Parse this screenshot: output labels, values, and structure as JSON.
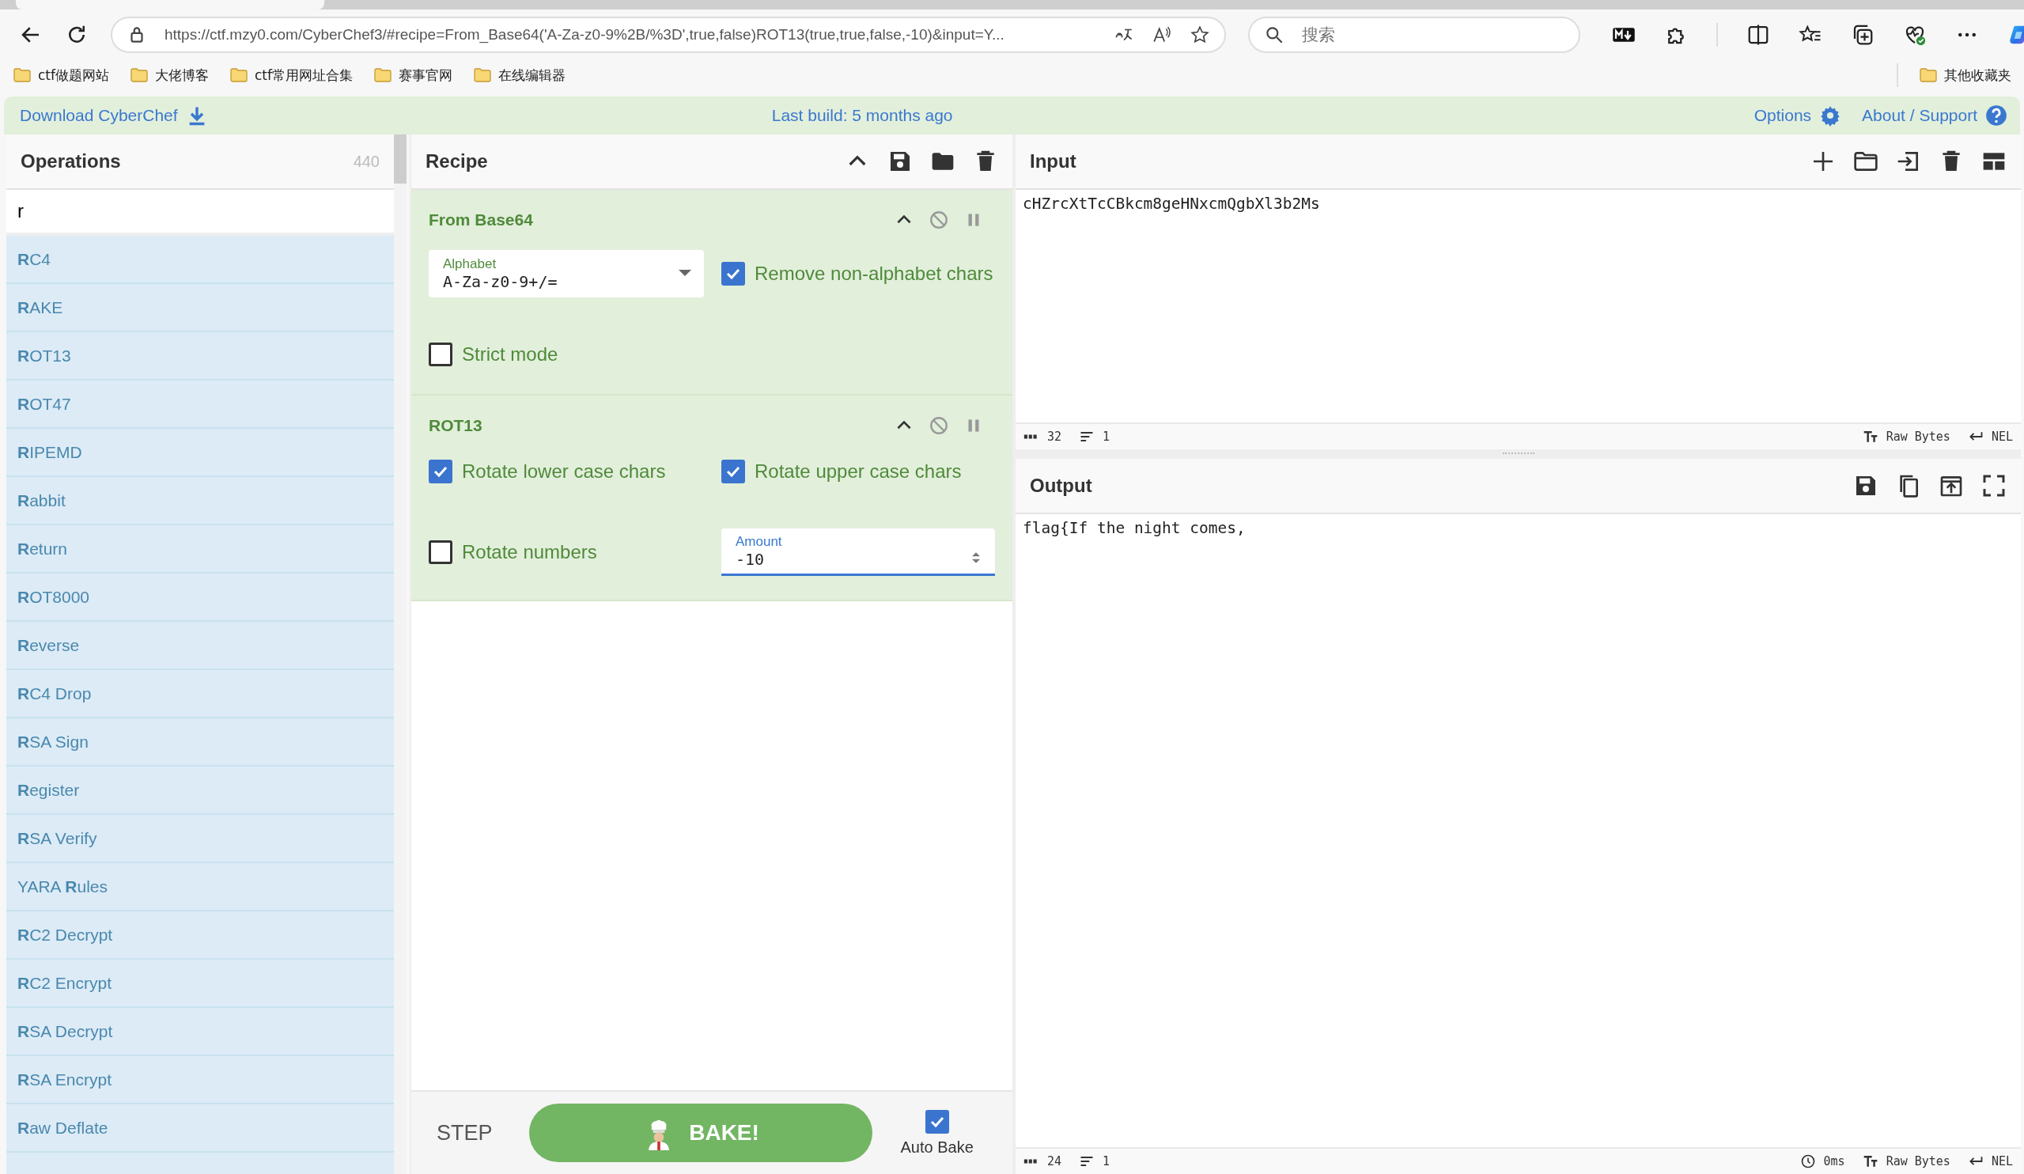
{
  "browser": {
    "url": "https://ctf.mzy0.com/CyberChef3/#recipe=From_Base64('A-Za-z0-9%2B/%3D',true,false)ROT13(true,true,false,-10)&input=Y...",
    "search_placeholder": "搜索",
    "bookmarks": [
      "ctf做题网站",
      "大佬博客",
      "ctf常用网址合集",
      "赛事官网",
      "在线编辑器"
    ],
    "other_bookmarks": "其他收藏夹"
  },
  "banner": {
    "download": "Download CyberChef",
    "last_build": "Last build: 5 months ago",
    "options": "Options",
    "about": "About / Support"
  },
  "operations": {
    "title": "Operations",
    "count": "440",
    "search_value": "r",
    "items": [
      "**R**C4",
      "**R**AKE",
      "**R**OT13",
      "**R**OT47",
      "**R**IPEMD",
      "**R**abbit",
      "**R**eturn",
      "**R**OT8000",
      "**R**everse",
      "**R**C4 Drop",
      "**R**SA Sign",
      "**R**egister",
      "**R**SA Verify",
      "YARA **R**ules",
      "**R**C2 Decrypt",
      "**R**C2 Encrypt",
      "**R**SA Decrypt",
      "**R**SA Encrypt",
      "**R**aw Deflate"
    ]
  },
  "recipe": {
    "title": "Recipe",
    "steps": [
      {
        "name": "From Base64",
        "args": [
          {
            "kind": "select",
            "label": "Alphabet",
            "value": "A-Za-z0-9+/="
          },
          {
            "kind": "checkbox",
            "label": "Remove non-alphabet chars",
            "checked": true
          },
          {
            "kind": "checkbox",
            "label": "Strict mode",
            "checked": false
          }
        ]
      },
      {
        "name": "ROT13",
        "args": [
          {
            "kind": "checkbox",
            "label": "Rotate lower case chars",
            "checked": true
          },
          {
            "kind": "checkbox",
            "label": "Rotate upper case chars",
            "checked": true
          },
          {
            "kind": "checkbox",
            "label": "Rotate numbers",
            "checked": false
          },
          {
            "kind": "number",
            "label": "Amount",
            "value": "-10"
          }
        ]
      }
    ],
    "step_label": "STEP",
    "bake_label": "BAKE!",
    "auto_bake": {
      "label": "Auto Bake",
      "checked": true
    }
  },
  "input": {
    "title": "Input",
    "value": "cHZrcXtTcCBkcm8geHNxcmQgbXl3b2Ms",
    "chars": "32",
    "lines": "1",
    "encoding": "Raw Bytes",
    "eol": "NEL"
  },
  "output": {
    "title": "Output",
    "value": "flag{If the night comes,",
    "chars": "24",
    "lines": "1",
    "time": "0ms",
    "encoding": "Raw Bytes",
    "eol": "NEL"
  }
}
